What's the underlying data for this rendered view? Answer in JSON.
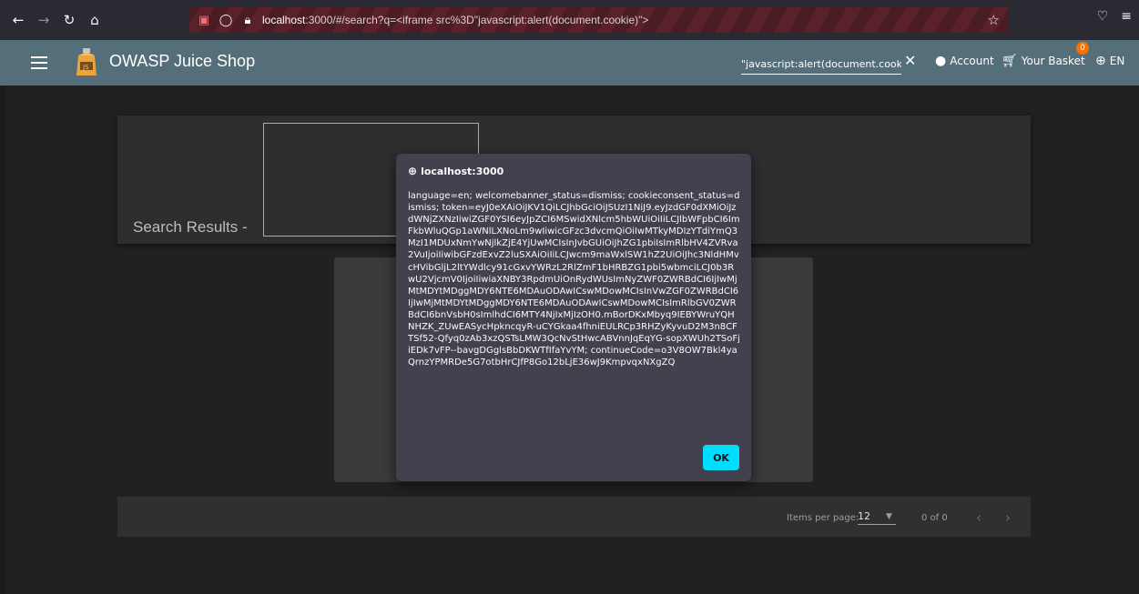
{
  "browser": {
    "back_icon": "←",
    "forward_icon": "→",
    "reload_icon": "↻",
    "home_icon": "⌂",
    "url_host": "localhost",
    "url_rest": ":3000/#/search?q=<iframe src%3D\"javascript:alert(document.cookie)\">",
    "bookmark_icon": "☆",
    "pocket_icon": "♡",
    "menu_icon": "≡"
  },
  "toolbar": {
    "app_title": "OWASP Juice Shop",
    "search_value": "\"javascript:alert(document.cookie)\">",
    "clear_icon": "✕",
    "account_label": "Account",
    "basket_label": "Your Basket",
    "basket_count": "0",
    "language_label": "EN",
    "colors": {
      "toolbar": "#546e7a",
      "badge": "#ff6f00"
    }
  },
  "main": {
    "results_title": "Search Results -"
  },
  "paginator": {
    "items_per_page_label": "Items per page:",
    "items_per_page_value": "12",
    "range_label": "0 of 0"
  },
  "dialog": {
    "origin": "localhost:3000",
    "message": "language=en; welcomebanner_status=dismiss; cookieconsent_status=dismiss; token=eyJ0eXAiOiJKV1QiLCJhbGciOiJSUzI1NiJ9.eyJzdGF0dXMiOiJzdWNjZXNzIiwiZGF0YSI6eyJpZCI6MSwidXNlcm5hbWUiOiIiLCJlbWFpbCI6ImFkbWluQGp1aWNlLXNoLm9wIiwicGFzc3dvcmQiOiIwMTkyMDIzYTdiYmQ3MzI1MDUxNmYwNjlkZjE4YjUwMCIsInJvbGUiOiJhZG1pbiIsImRlbHV4ZVRva2VuIjoiIiwibGFzdExvZ2luSXAiOiIiLCJwcm9maWxlSW1hZ2UiOiJhc3NldHMvcHVibGljL2ltYWdlcy91cGxvYWRzL2RlZmF1bHRBZG1pbi5wbmciLCJ0b3RwU2VjcmV0IjoiIiwiaXNBY3RpdmUiOnRydWUsImNyZWF0ZWRBdCI6IjIwMjMtMDYtMDggMDY6NTE6MDAuODAwICswMDowMCIsInVwZGF0ZWRBdCI6IjIwMjMtMDYtMDggMDY6NTE6MDAuODAwICswMDowMCIsImRlbGV0ZWRBdCI6bnVsbH0sImlhdCI6MTY4NjIxMjIzOH0.mBorDKxMbyq9IEBYWruYQHNHZK_ZUwEASycHpkncqyR-uCYGkaa4fhniEULRCp3RHZyKyvuD2M3n8CFTSf52-Qfyq0zAb3xzQSTsLMW3QcNvStHwcABVnnJqEqYG-sopXWUh2TSoFjiEDk7vFP--bavgDGglsBbDKWTfIfaYvYM; continueCode=o3V8OW7Bkl4yaQrnzYPMRDe5G7otbHrCJfP8Go12bLjE36wJ9KmpvqxNXgZQ",
    "ok_label": "OK",
    "colors": {
      "background": "#42414d",
      "ok_button": "#00ddff"
    }
  }
}
